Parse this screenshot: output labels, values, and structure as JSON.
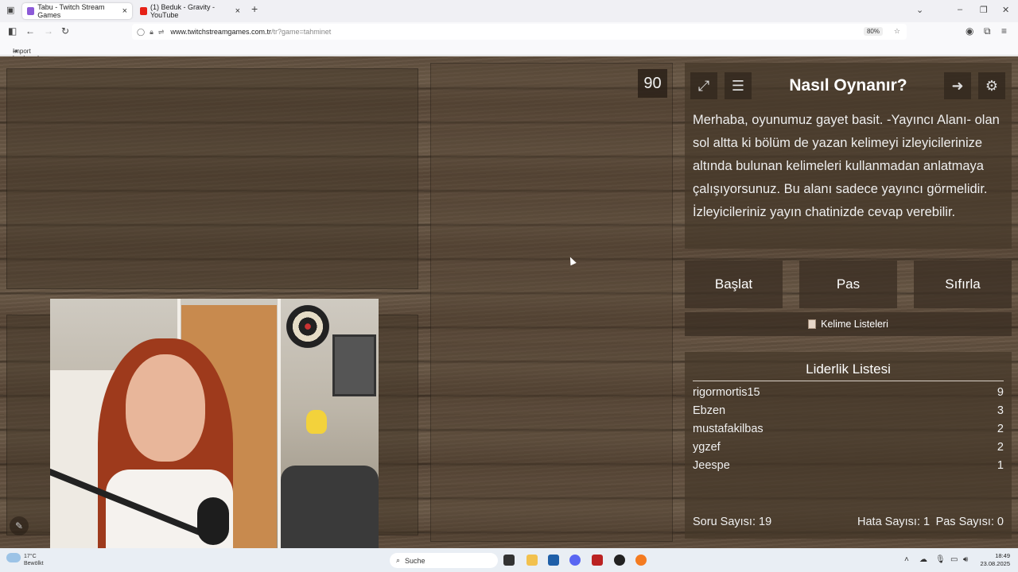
{
  "browser": {
    "tabs": [
      {
        "label": "Tabu - Twitch Stream Games",
        "active": true
      },
      {
        "label": "(1) Beduk - Gravity - YouTube",
        "active": false
      }
    ],
    "url_host": "www.twitchstreamgames.com.tr",
    "url_path": "/tr?game=tahminet",
    "zoom": "80%",
    "bookmark": "Import bookmarks..."
  },
  "game": {
    "timer": "90",
    "howto_title": "Nasıl Oynanır?",
    "howto_text": "Merhaba, oyunumuz gayet basit. -Yayıncı Alanı- olan sol altta ki bölüm de yazan kelimeyi izleyicilerinize altında bulunan kelimeleri kullanmadan anlatmaya çalışıyorsunuz. Bu alanı sadece yayıncı görmelidir. İzleyicileriniz yayın chatinizde cevap verebilir.",
    "buttons": {
      "start": "Başlat",
      "pass": "Pas",
      "reset": "Sıfırla"
    },
    "word_lists": "Kelime Listeleri",
    "leaderboard": {
      "title": "Liderlik Listesi",
      "rows": [
        {
          "name": "rigormortis15",
          "score": "9"
        },
        {
          "name": "Ebzen",
          "score": "3"
        },
        {
          "name": "mustafakilbas",
          "score": "2"
        },
        {
          "name": "ygzef",
          "score": "2"
        },
        {
          "name": "Jeespe",
          "score": "1"
        }
      ]
    },
    "stats": {
      "questions": "Soru Sayısı: 19",
      "errors": "Hata Sayısı: 1",
      "passes": "Pas Sayısı: 0"
    }
  },
  "taskbar": {
    "weather_temp": "17°C",
    "weather_desc": "Bewölkt",
    "search": "Suche",
    "time": "18:49",
    "date": "23.08.2025"
  }
}
